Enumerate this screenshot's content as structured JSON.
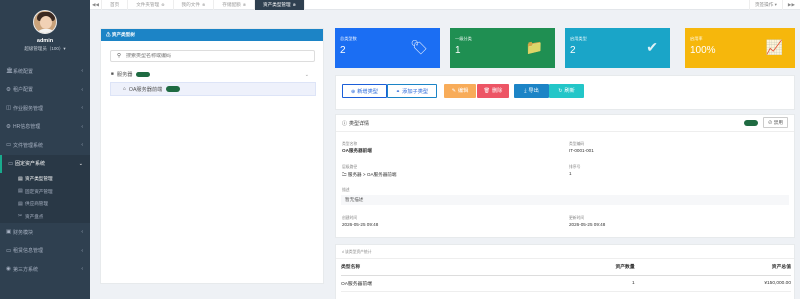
{
  "user": {
    "name": "admin",
    "role": "超级管理员（100）▾"
  },
  "nav": {
    "items": [
      {
        "icon": "🏛",
        "label": "系统配置"
      },
      {
        "icon": "⚙",
        "label": "租户配置"
      },
      {
        "icon": "◫",
        "label": "作业服务管理"
      },
      {
        "icon": "⚙",
        "label": "HR信息管理"
      },
      {
        "icon": "▭",
        "label": "文件管理系统"
      }
    ],
    "active": {
      "icon": "▭",
      "label": "固定资产系统"
    },
    "subs": [
      {
        "icon": "▤",
        "label": "资产类型管理"
      },
      {
        "icon": "▤",
        "label": "固定资产管理"
      },
      {
        "icon": "▤",
        "label": "供应商管理"
      },
      {
        "icon": "✂",
        "label": "资产盘点"
      }
    ],
    "bottom": [
      {
        "icon": "▣",
        "label": "财务模块"
      },
      {
        "icon": "▭",
        "label": "租赁信息管理"
      },
      {
        "icon": "◉",
        "label": "第三方系统"
      }
    ]
  },
  "topbar": {
    "controls": [
      "◀◀",
      "▶"
    ],
    "tabs": [
      {
        "label": "首页",
        "close": ""
      },
      {
        "label": "文件夹管理",
        "close": "⊗"
      },
      {
        "label": "我的文件",
        "close": "⊗"
      },
      {
        "label": "存储配额",
        "close": "⊗"
      },
      {
        "label": "资产类型管理",
        "close": "⊗"
      }
    ],
    "right": [
      "页签操作 ▾",
      "▶▶"
    ]
  },
  "tree": {
    "title": "⚠ 资产类型树",
    "search_placeholder": "搜索类型名称或编码",
    "root": "服务器",
    "child": "OA服务器前端"
  },
  "cards": [
    {
      "label": "总类型数",
      "value": "2",
      "icon": "🏷"
    },
    {
      "label": "一级分类",
      "value": "1",
      "icon": "📁"
    },
    {
      "label": "启用类型",
      "value": "2",
      "icon": "✔"
    },
    {
      "label": "启用率",
      "value": "100%",
      "icon": "📈"
    }
  ],
  "toolbar": {
    "add": "新增类型",
    "add_sub": "添加子类型",
    "edit": "编辑",
    "delete": "删除",
    "export": "导出",
    "refresh": "刷新"
  },
  "detail": {
    "title": "类型详情",
    "disable": "禁用",
    "name_label": "类型名称",
    "name": "OA服务器前端",
    "code_label": "类型编码",
    "code": "IT-0001-001",
    "path_label": "层级路径",
    "path": "🗀 服务器 > OA服务器前端",
    "sort_label": "排序号",
    "sort": "1",
    "desc_label": "描述",
    "desc": "暂无描述",
    "created_label": "创建时间",
    "created": "2026-05-25 09:48",
    "updated_label": "更新时间",
    "updated": "2026-05-25 09:48"
  },
  "stats": {
    "title": "ıl 该类型资产统计",
    "headers": [
      "类型名称",
      "资产数量",
      "资产总值"
    ],
    "rows": [
      [
        "OA服务器前端",
        "1",
        "¥150,000.00"
      ]
    ]
  }
}
